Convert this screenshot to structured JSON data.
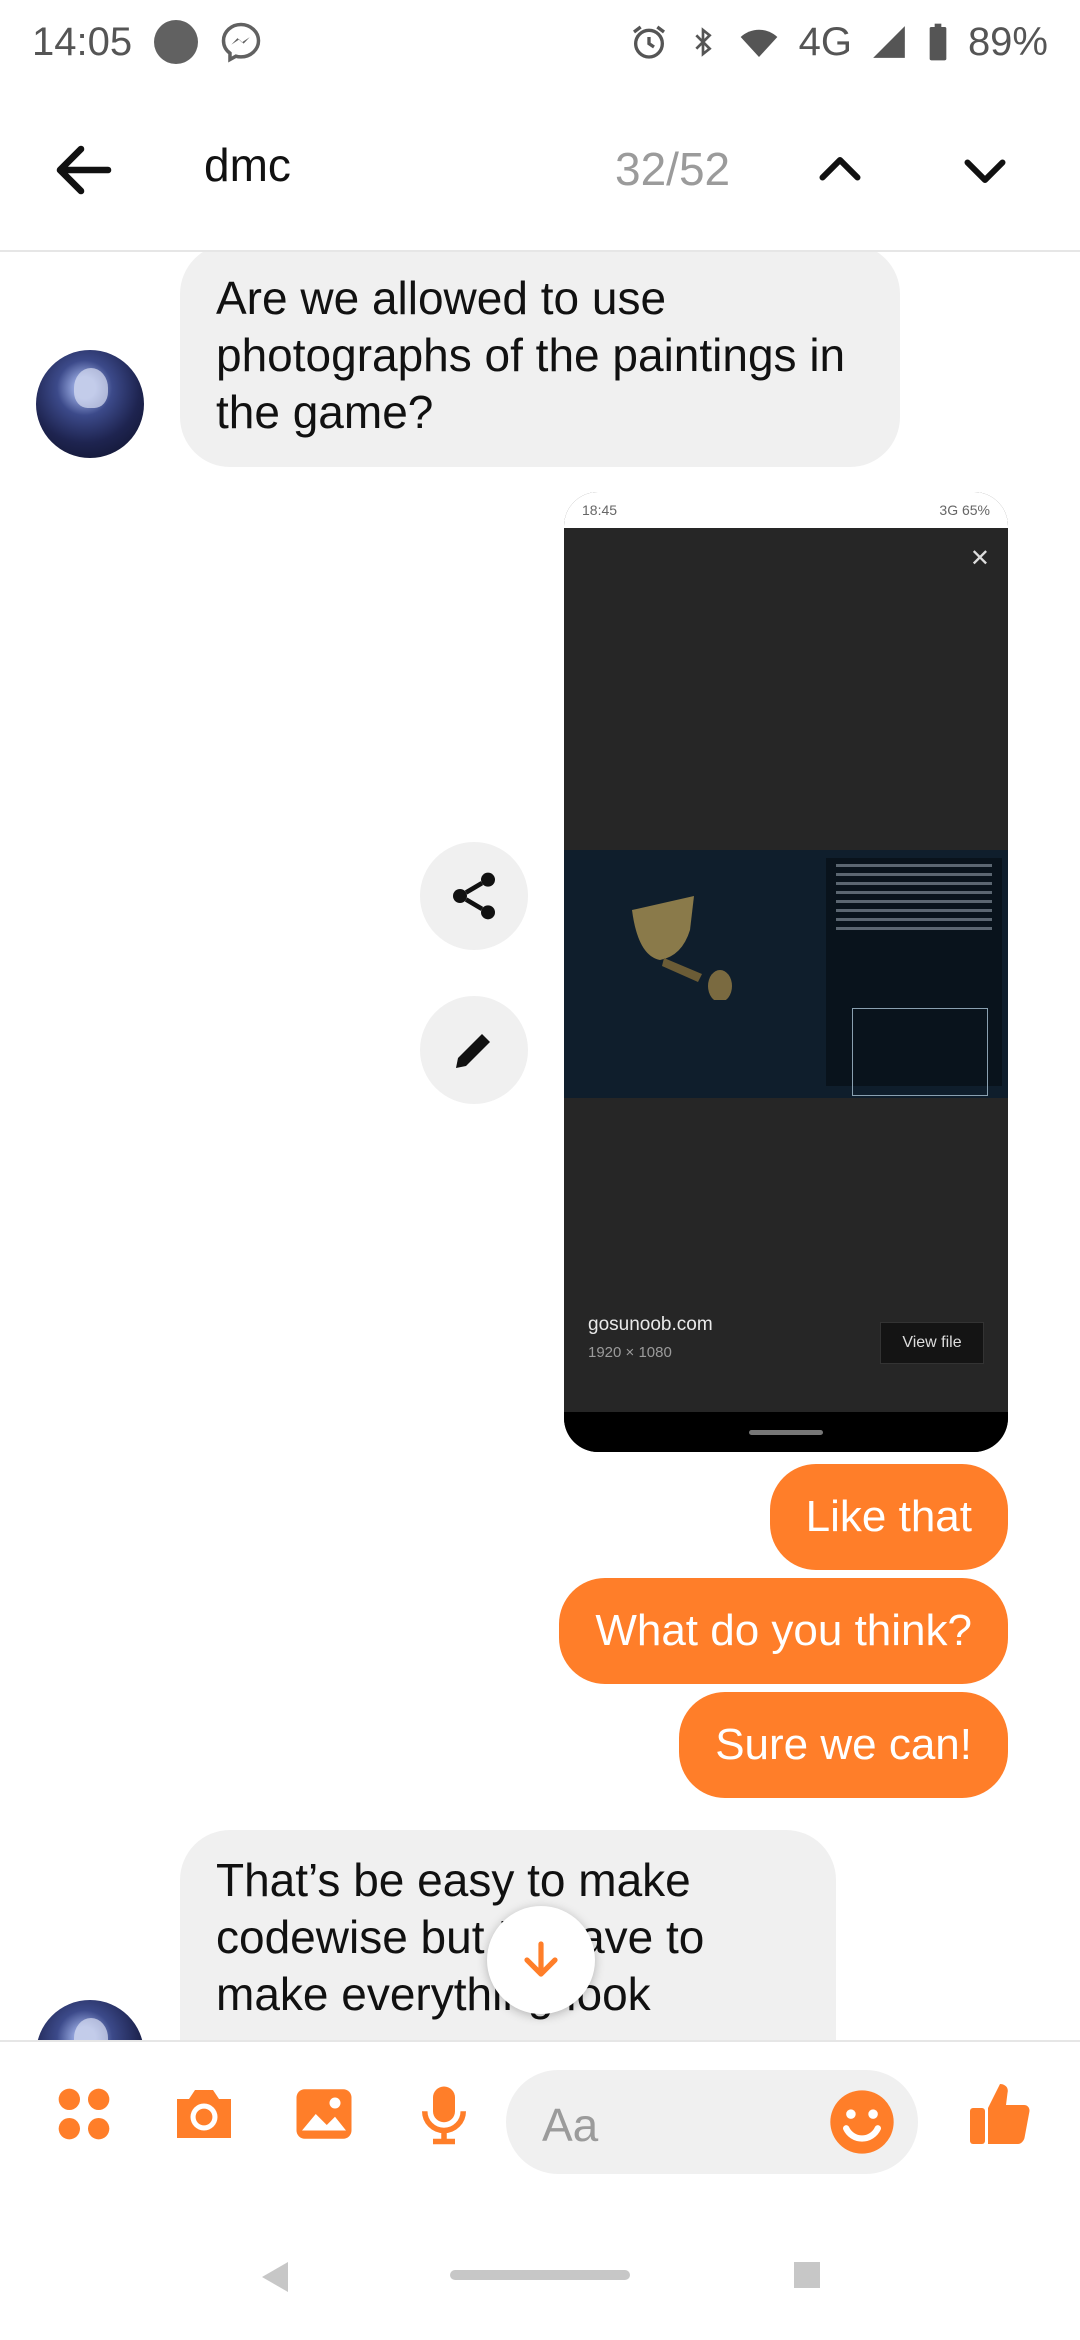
{
  "status_bar": {
    "time": "14:05",
    "network": "4G",
    "battery": "89%"
  },
  "search": {
    "term": "dmc",
    "count": "32/52"
  },
  "messages": {
    "incoming_1": "Are we allowed to use photographs of the paintings in the game?",
    "outgoing": [
      "Like that",
      "What do you think?",
      "Sure we can!"
    ],
    "incoming_2": "That’s be easy to make codewise but I’ll have to make everything look"
  },
  "attachment": {
    "status_time": "18:45",
    "status_right": "3G 65%",
    "domain": "gosunoob.com",
    "dimensions": "1920 × 1080",
    "view_button": "View file"
  },
  "composer": {
    "placeholder": "Aa"
  },
  "colors": {
    "accent": "#ff7e29",
    "bubble_in": "#f0f0f0"
  }
}
